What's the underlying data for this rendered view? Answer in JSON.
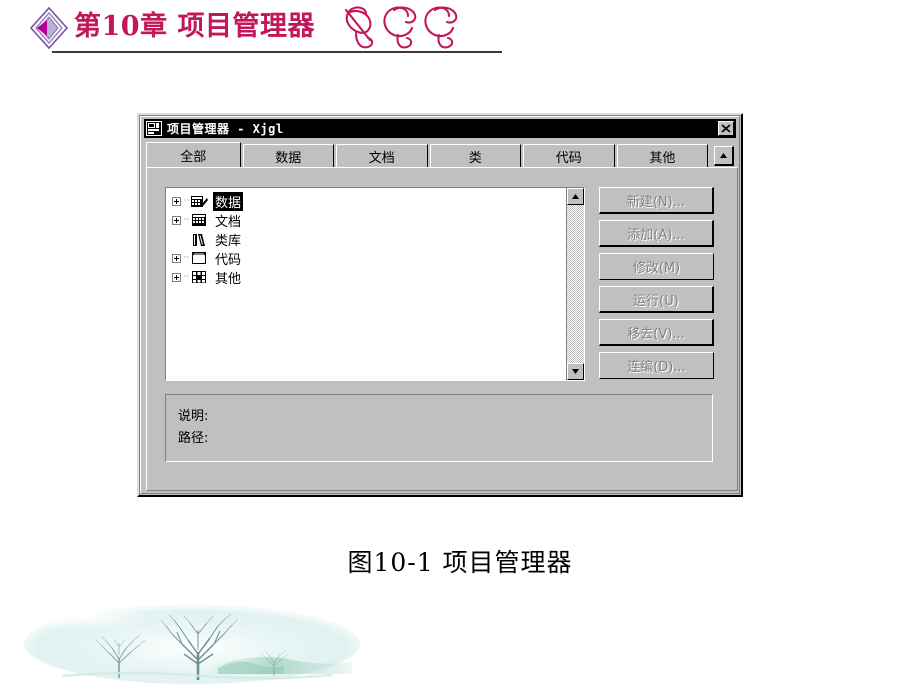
{
  "slide": {
    "chapter_title": "第10章 项目管理器",
    "flourish_label": "decorative-script-ornament",
    "figure_caption": "图10-1  项目管理器"
  },
  "dialog": {
    "title": "项目管理器 - Xjgl",
    "icon_name": "project-manager-icon",
    "close_label": "×",
    "tabs": [
      {
        "label": "全部",
        "active": true
      },
      {
        "label": "数据",
        "active": false
      },
      {
        "label": "文档",
        "active": false
      },
      {
        "label": "类",
        "active": false
      },
      {
        "label": "代码",
        "active": false
      },
      {
        "label": "其他",
        "active": false
      }
    ],
    "tab_scroll_button": "▲",
    "tree": [
      {
        "label": "数据",
        "icon": "table-pencil-icon",
        "expandable": true,
        "selected": true
      },
      {
        "label": "文档",
        "icon": "grid-table-icon",
        "expandable": true,
        "selected": false
      },
      {
        "label": "类库",
        "icon": "class-library-icon",
        "expandable": false,
        "selected": false
      },
      {
        "label": "代码",
        "icon": "window-code-icon",
        "expandable": true,
        "selected": false
      },
      {
        "label": "其他",
        "icon": "squares-grid-icon",
        "expandable": true,
        "selected": false
      }
    ],
    "scrollbar": {
      "up_arrow": "▲",
      "down_arrow": "▼"
    },
    "buttons": [
      {
        "label": "新建(N)...",
        "disabled": true,
        "default": true
      },
      {
        "label": "添加(A)...",
        "disabled": true,
        "default": true
      },
      {
        "label": "修改(M)",
        "disabled": true,
        "default": false
      },
      {
        "label": "运行(U)",
        "disabled": true,
        "default": false
      },
      {
        "label": "移去(V)...",
        "disabled": true,
        "default": true
      },
      {
        "label": "连编(D)...",
        "disabled": true,
        "default": false
      }
    ],
    "info": {
      "description_label": "说明:",
      "description_value": "",
      "path_label": "路径:",
      "path_value": ""
    }
  },
  "colors": {
    "title_pink": "#c2185b",
    "bullet_purple": "#a020c0",
    "dialog_face": "#c0c0c0",
    "titlebar_bg": "#000000",
    "tree_bg": "#ffffff",
    "disabled_text": "#808080"
  }
}
